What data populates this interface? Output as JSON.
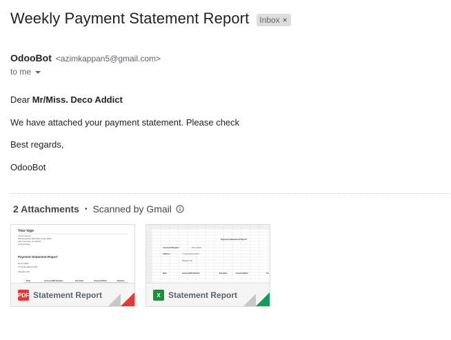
{
  "email": {
    "subject": "Weekly Payment Statement Report",
    "label": "Inbox",
    "label_remove": "×",
    "sender_name": "OdooBot",
    "sender_email": "<azimkappan5@gmail.com>",
    "recipient": "to me",
    "body": {
      "greeting_prefix": "Dear ",
      "greeting_name": "Mr/Miss. Deco Addict",
      "line1": "We have attached your payment statement. Please check",
      "line2": "Best regards,",
      "signature": "OdooBot"
    }
  },
  "attachments": {
    "count_label": "2 Attachments",
    "separator": "•",
    "scanned_label": "Scanned by Gmail",
    "items": [
      {
        "name": "Statement Report",
        "type_badge": "PDF",
        "type_color": "#e53935",
        "corner_color": "#e53935",
        "thumb": {
          "logo": "Your logo",
          "company": "YourCompany",
          "address": "250 Executive Park Blvd, Suite 3400",
          "city": "San Francisco CA 94134",
          "country": "United States",
          "doc_title": "Payment Statement Report",
          "customer": "Deco Addict",
          "street": "77 Santa Barbara Rd",
          "town": "Pleasant Hill",
          "cols": [
            "Date",
            "Invoices/Bill Number",
            "Due Date",
            "Invoices/Debit",
            "Balance"
          ]
        }
      },
      {
        "name": "Statement Report",
        "type_badge": "X",
        "type_color": "#1e8e3e",
        "corner_color": "#0f9d58",
        "thumb": {
          "doc_title": "Payment Statement Report",
          "customer_label": "Customer/Supplier :",
          "customer": "Deco Addict",
          "address_label": "Address :",
          "street": "77 Santa Barbara Rd",
          "town": "Pleasant Hill",
          "cols": [
            "Date",
            "Invoices/Bill Number",
            "Due Date",
            "Invoices/Debit",
            "Inv"
          ]
        }
      }
    ]
  },
  "colors": {
    "text": "#202124",
    "muted": "#5f6368",
    "chip_bg": "#dddddd"
  }
}
